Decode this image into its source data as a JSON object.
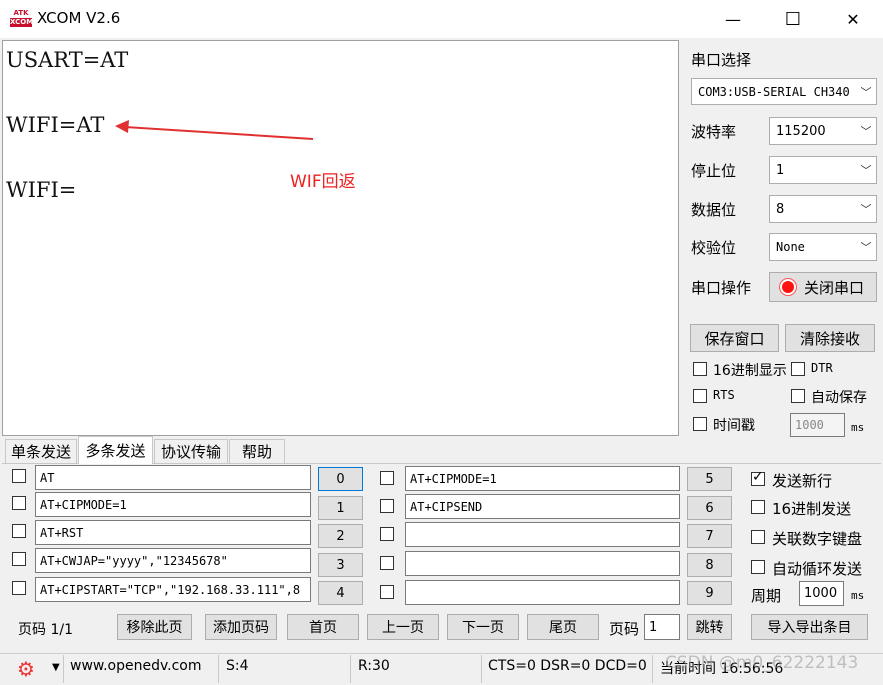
{
  "window": {
    "title": "XCOM V2.6",
    "logo_top": "ATK",
    "logo_bottom": "XCOM",
    "minimize": "—",
    "maximize": "☐",
    "close": "✕"
  },
  "receive": {
    "lines": [
      "USART=AT",
      "WIFI=AT",
      "WIFI="
    ],
    "annotation": "WIF回返"
  },
  "serial": {
    "port_select_label": "串口选择",
    "port_value": "COM3:USB-SERIAL CH340",
    "baud_label": "波特率",
    "baud_value": "115200",
    "stopbit_label": "停止位",
    "stopbit_value": "1",
    "databit_label": "数据位",
    "databit_value": "8",
    "parity_label": "校验位",
    "parity_value": "None",
    "op_label": "串口操作",
    "op_button": "关闭串口",
    "save_window": "保存窗口",
    "clear_receive": "清除接收",
    "hex_display": "16进制显示",
    "dtr": "DTR",
    "rts": "RTS",
    "auto_save": "自动保存",
    "timestamp": "时间戳",
    "timestamp_value": "1000",
    "ms": "ms"
  },
  "tabs": [
    "单条发送",
    "多条发送",
    "协议传输",
    "帮助"
  ],
  "multi_send": {
    "left": [
      {
        "text": "AT",
        "num": "0"
      },
      {
        "text": "AT+CIPMODE=1",
        "num": "1"
      },
      {
        "text": "AT+RST",
        "num": "2"
      },
      {
        "text": "AT+CWJAP=\"yyyy\",\"12345678\"",
        "num": "3"
      },
      {
        "text": "AT+CIPSTART=\"TCP\",\"192.168.33.111\",8",
        "num": "4"
      }
    ],
    "right": [
      {
        "text": "AT+CIPMODE=1",
        "num": "5"
      },
      {
        "text": "AT+CIPSEND",
        "num": "6"
      },
      {
        "text": "",
        "num": "7"
      },
      {
        "text": "",
        "num": "8"
      },
      {
        "text": "",
        "num": "9"
      }
    ],
    "send_newline": "发送新行",
    "hex_send": "16进制发送",
    "link_keypad": "关联数字键盘",
    "auto_loop": "自动循环发送",
    "period_label": "周期",
    "period_value": "1000",
    "ms": "ms",
    "page_label": "页码 1/1",
    "remove_page": "移除此页",
    "add_page": "添加页码",
    "first_page": "首页",
    "prev_page": "上一页",
    "next_page": "下一页",
    "last_page": "尾页",
    "page_input_label": "页码",
    "page_input_value": "1",
    "jump": "跳转",
    "import_export": "导入导出条目"
  },
  "status": {
    "url": "www.openedv.com",
    "sent": "S:4",
    "recv": "R:30",
    "lines": "CTS=0 DSR=0 DCD=0",
    "time": "当前时间 16:56:56",
    "watermark": "CSDN @m0_62222143"
  },
  "colors": {
    "accent_button_border": "#0078d7",
    "annotation": "#e22222",
    "arrow": "#e03030",
    "record_red": "#ff1111"
  }
}
